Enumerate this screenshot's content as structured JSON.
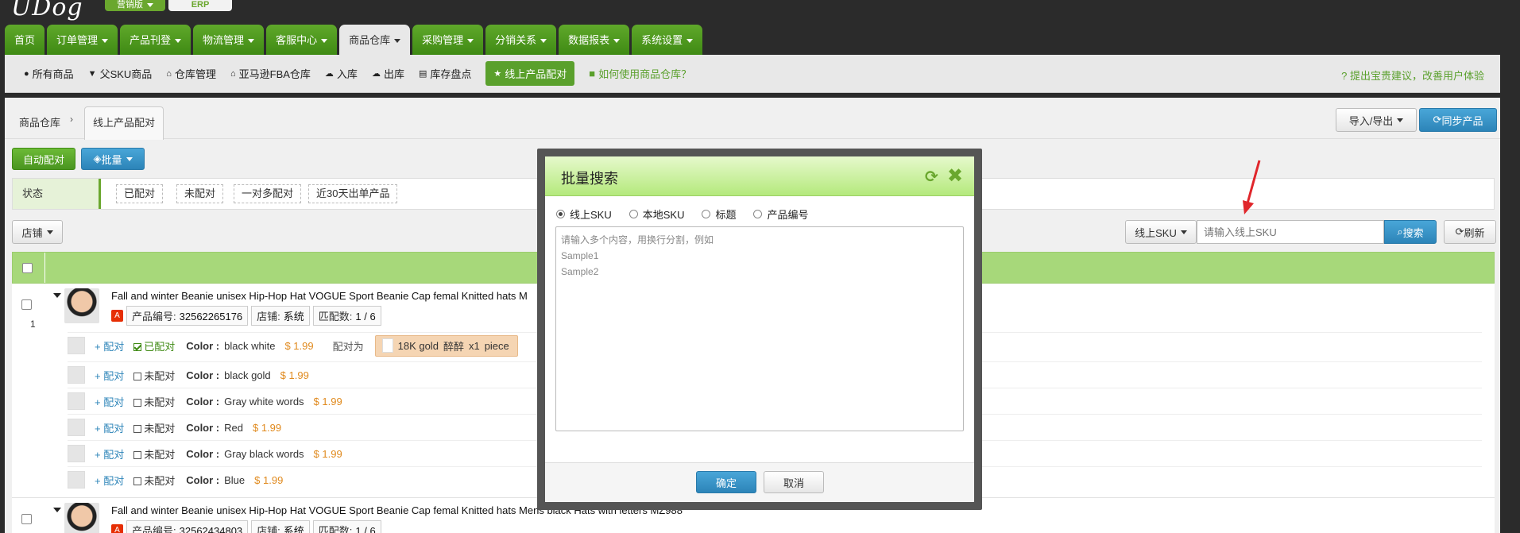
{
  "app": {
    "logo": "UDog",
    "edition_marketing": "营销版",
    "edition_erp": "ERP"
  },
  "nav": {
    "tabs": [
      {
        "label": "首页"
      },
      {
        "label": "订单管理"
      },
      {
        "label": "产品刊登"
      },
      {
        "label": "物流管理"
      },
      {
        "label": "客服中心"
      },
      {
        "label": "商品仓库"
      },
      {
        "label": "采购管理"
      },
      {
        "label": "分销关系"
      },
      {
        "label": "数据报表"
      },
      {
        "label": "系统设置"
      }
    ]
  },
  "subnav": {
    "items": [
      {
        "label": "所有商品",
        "icon": "circle-icon"
      },
      {
        "label": "父SKU商品",
        "icon": "filter-icon"
      },
      {
        "label": "仓库管理",
        "icon": "home-icon"
      },
      {
        "label": "亚马逊FBA仓库",
        "icon": "home-icon"
      },
      {
        "label": "入库",
        "icon": "cloud-upload-icon"
      },
      {
        "label": "出库",
        "icon": "cloud-download-icon"
      },
      {
        "label": "库存盘点",
        "icon": "list-icon"
      },
      {
        "label": "线上产品配对",
        "icon": "star-icon"
      }
    ],
    "help": "如何使用商品仓库？",
    "feedback": "提出宝贵建议，改善用户体验"
  },
  "breadcrumb": {
    "parent": "商品仓库",
    "sep": "›",
    "current": "线上产品配对"
  },
  "toolbar": {
    "import_export": "导入/导出",
    "sync": "同步产品",
    "auto_match": "自动配对",
    "batch": "批量"
  },
  "status_filter": {
    "label": "状态",
    "chips": [
      "已配对",
      "未配对",
      "一对多配对",
      "近30天出单产品"
    ]
  },
  "search": {
    "shop_label": "店铺",
    "field": "线上SKU",
    "placeholder": "请输入线上SKU",
    "search_btn": "搜索",
    "refresh_btn": "刷新"
  },
  "products": [
    {
      "index": "1",
      "title": "Fall and winter Beanie unisex Hip-Hop Hat VOGUE Sport Beanie Cap femal Knitted hats M",
      "platform": "Ali",
      "product_no_label": "产品编号:",
      "product_no": "32562265176",
      "shop_label": "店铺:",
      "shop": "系统",
      "match_label": "匹配数:",
      "match": "1 / 6",
      "variants": [
        {
          "pair": "+ 配对",
          "status": "已配对",
          "matched": true,
          "color_label": "Color :",
          "color": "black white",
          "price": "$ 1.99",
          "pair_to": "配对为",
          "chip": "18K gold",
          "chip_name": "醉醉",
          "chip_qty": "x1",
          "chip_unit": "piece"
        },
        {
          "pair": "+ 配对",
          "status": "未配对",
          "matched": false,
          "color_label": "Color :",
          "color": "black gold",
          "price": "$ 1.99"
        },
        {
          "pair": "+ 配对",
          "status": "未配对",
          "matched": false,
          "color_label": "Color :",
          "color": "Gray white words",
          "price": "$ 1.99"
        },
        {
          "pair": "+ 配对",
          "status": "未配对",
          "matched": false,
          "color_label": "Color :",
          "color": "Red",
          "price": "$ 1.99"
        },
        {
          "pair": "+ 配对",
          "status": "未配对",
          "matched": false,
          "color_label": "Color :",
          "color": "Gray black words",
          "price": "$ 1.99"
        },
        {
          "pair": "+ 配对",
          "status": "未配对",
          "matched": false,
          "color_label": "Color :",
          "color": "Blue",
          "price": "$ 1.99"
        }
      ]
    },
    {
      "title": "Fall and winter Beanie unisex Hip-Hop Hat VOGUE Sport Beanie Cap femal Knitted hats Mens black Hats with letters MZ988",
      "product_no_label": "产品编号:",
      "product_no": "32562434803",
      "shop_label": "店铺:",
      "shop": "系统",
      "match_label": "匹配数:",
      "match": "1 / 6"
    }
  ],
  "modal": {
    "title": "批量搜索",
    "options": [
      {
        "label": "线上SKU",
        "selected": true
      },
      {
        "label": "本地SKU",
        "selected": false
      },
      {
        "label": "标题",
        "selected": false
      },
      {
        "label": "产品编号",
        "selected": false
      }
    ],
    "placeholder_lines": [
      "请输入多个内容，用换行分割，例如",
      "Sample1",
      "Sample2"
    ],
    "ok": "确定",
    "cancel": "取消"
  },
  "colors": {
    "brand_green": "#5aa02c",
    "accent_blue": "#2c84b8",
    "price_orange": "#e08a1e",
    "pointer_red": "#e0262b"
  }
}
